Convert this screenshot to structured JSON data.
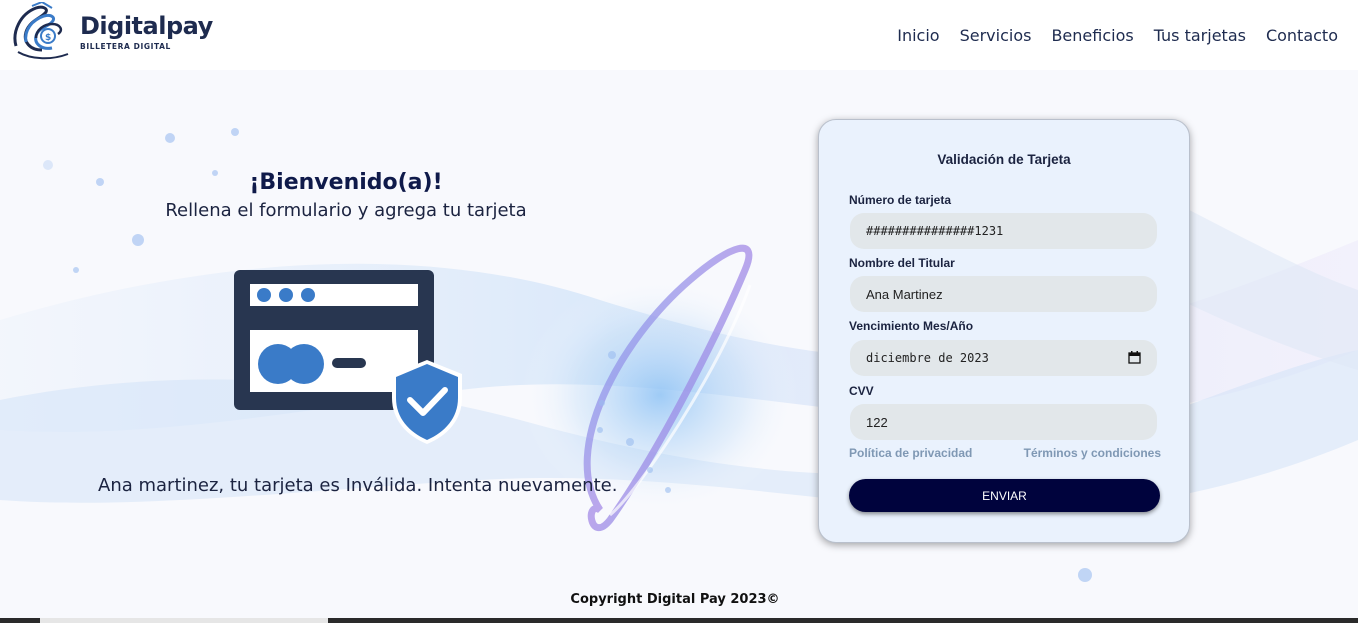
{
  "header": {
    "brand": "Digitalpay",
    "tagline": "BILLETERA DIGITAL",
    "nav": [
      "Inicio",
      "Servicios",
      "Beneficios",
      "Tus tarjetas",
      "Contacto"
    ]
  },
  "hero": {
    "title": "¡Bienvenido(a)!",
    "subtitle": "Rellena el formulario y agrega tu tarjeta",
    "result_message": "Ana martinez, tu tarjeta es Inválida. Intenta nuevamente."
  },
  "form": {
    "title": "Validación de Tarjeta",
    "card_number_label": "Número de tarjeta",
    "card_number_value": "###############1231",
    "holder_label": "Nombre del Titular",
    "holder_value": "Ana Martinez",
    "expiry_label": "Vencimiento Mes/Año",
    "expiry_value": "diciembre de 2023",
    "cvv_label": "CVV",
    "cvv_value": "122",
    "privacy_link": "Política de privacidad",
    "terms_link": "Términos y condiciones",
    "submit_label": "ENVIAR"
  },
  "footer": {
    "copyright": "Copyright Digital Pay 2023©"
  },
  "colors": {
    "brand_navy": "#1e2b4f",
    "button": "#00033d",
    "card_bg": "#eaf2fd",
    "illustration_dark": "#283650",
    "illustration_blue": "#3a7bc8"
  },
  "icons": [
    "logo-icon",
    "card-illustration-icon",
    "shield-check-icon",
    "calendar-icon"
  ]
}
